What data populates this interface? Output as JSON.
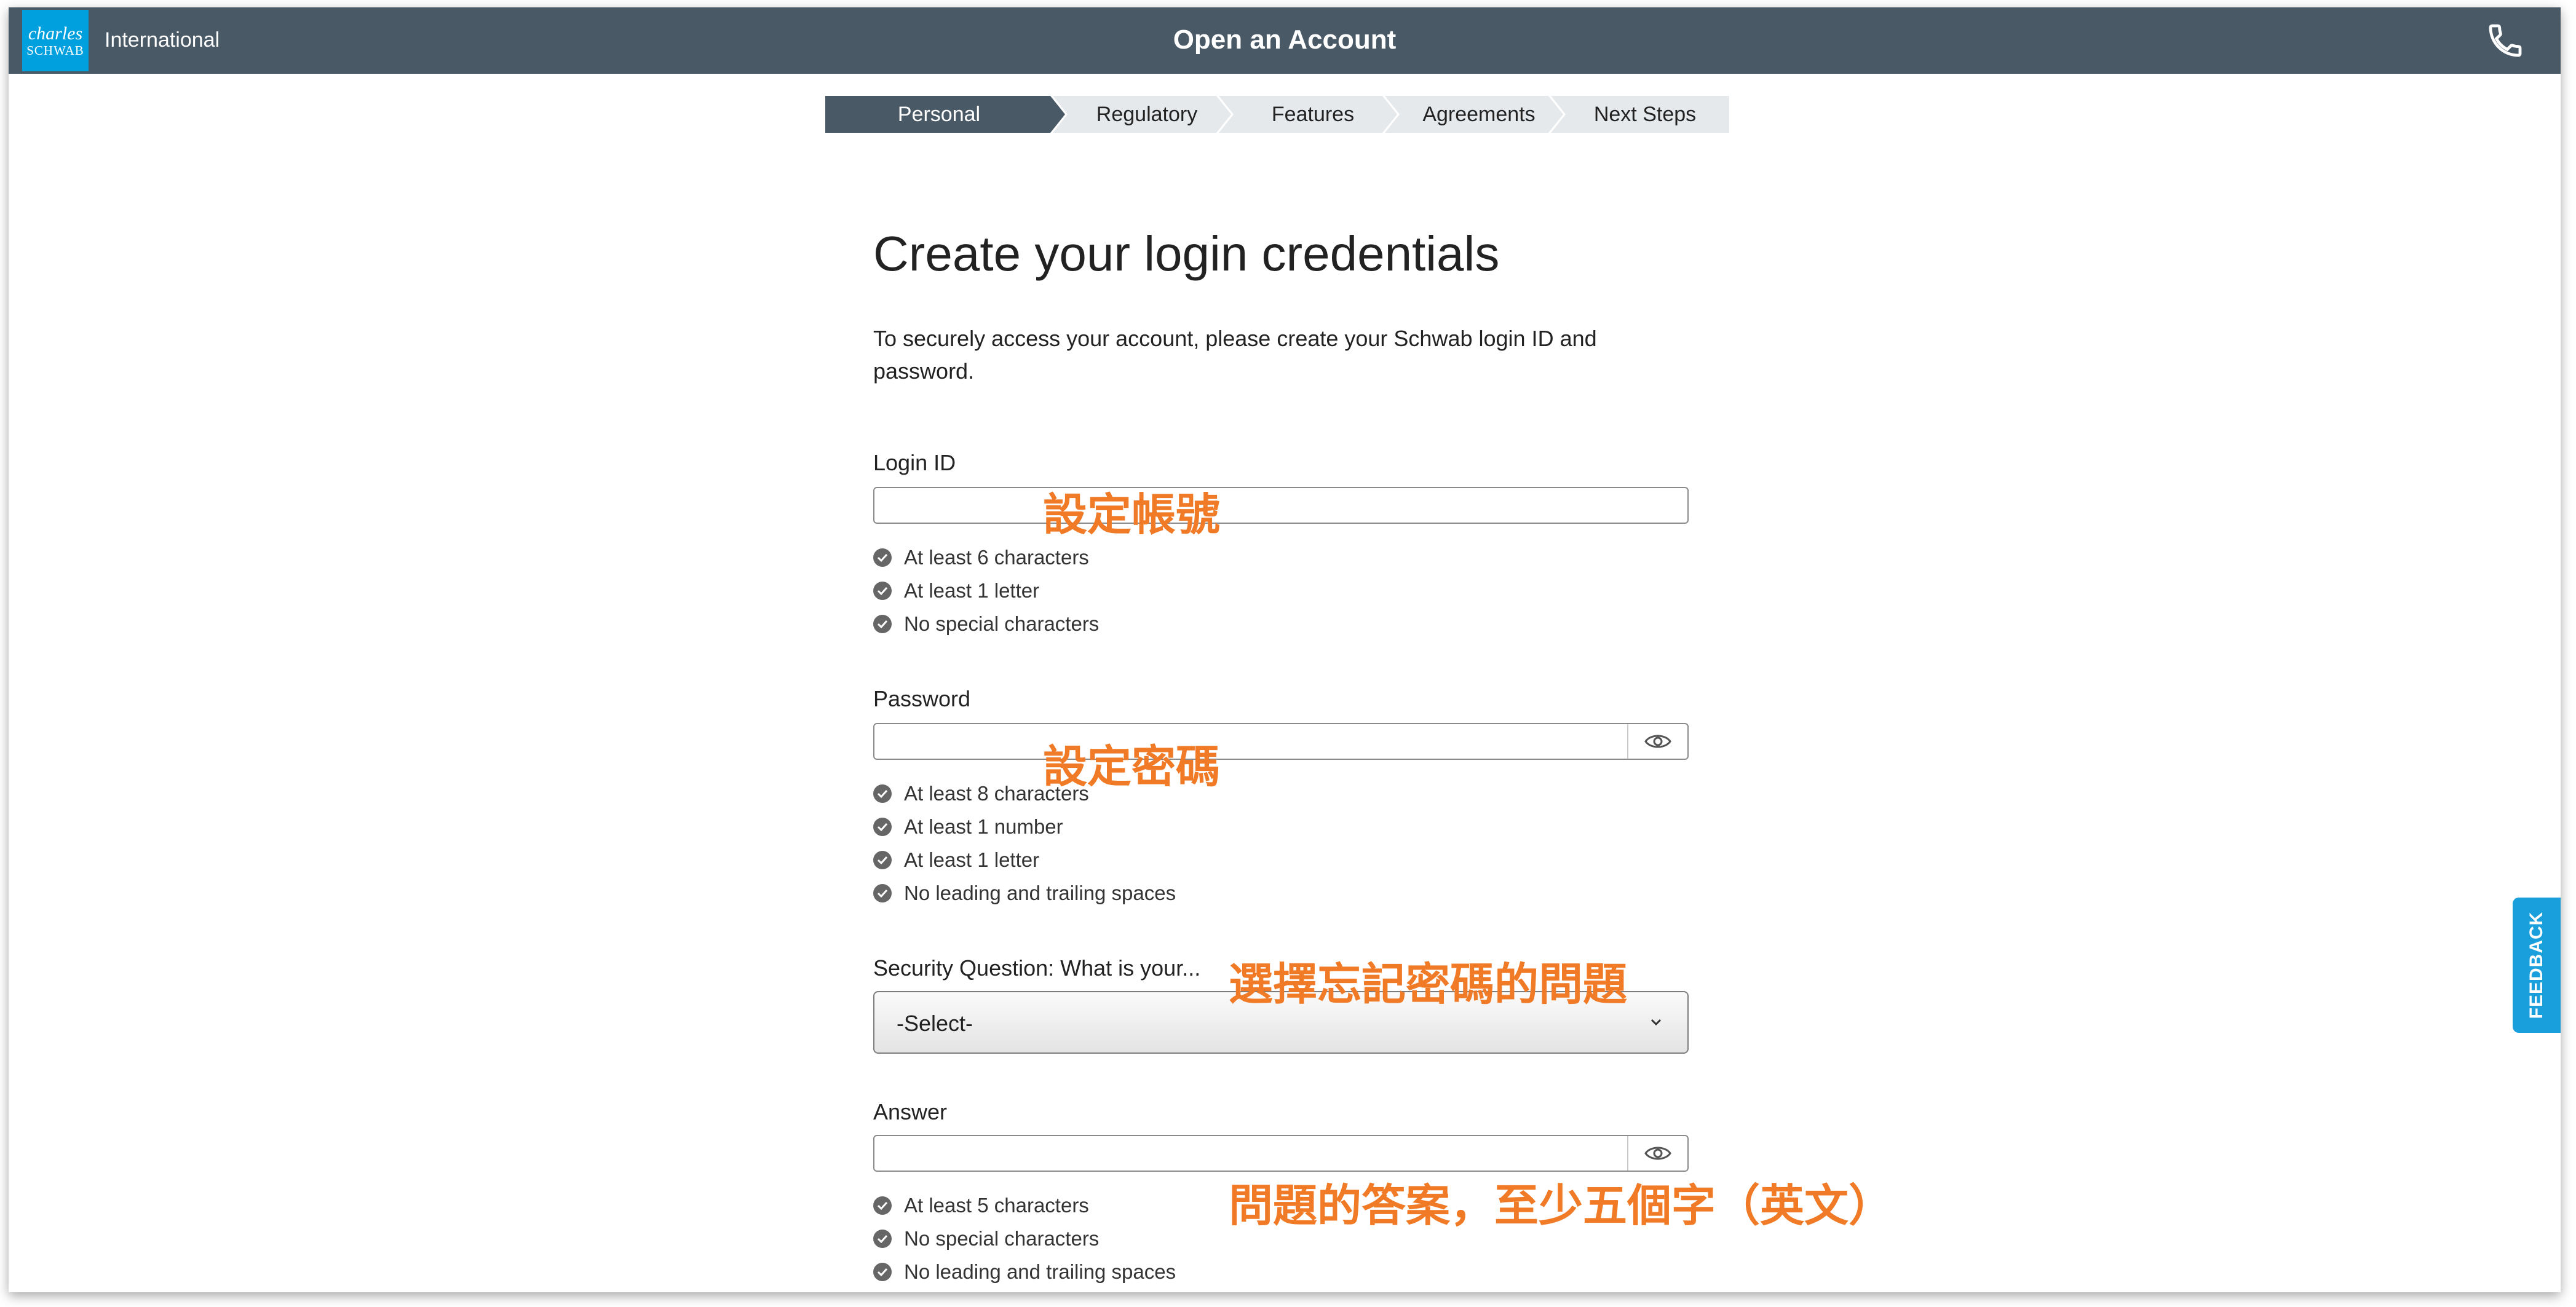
{
  "header": {
    "logo_line1": "charles",
    "logo_line2": "SCHWAB",
    "region": "International",
    "title": "Open an Account",
    "phone_icon": "phone-icon"
  },
  "steps": [
    {
      "label": "Personal",
      "active": true
    },
    {
      "label": "Regulatory",
      "active": false
    },
    {
      "label": "Features",
      "active": false
    },
    {
      "label": "Agreements",
      "active": false
    },
    {
      "label": "Next Steps",
      "active": false
    }
  ],
  "page": {
    "heading": "Create your login credentials",
    "intro": "To securely access your account, please create your Schwab login ID and password."
  },
  "login": {
    "label": "Login ID",
    "value": "",
    "rules": [
      "At least 6 characters",
      "At least 1 letter",
      "No special characters"
    ]
  },
  "password": {
    "label": "Password",
    "value": "",
    "rules": [
      "At least 8 characters",
      "At least 1 number",
      "At least 1 letter",
      "No leading and trailing spaces"
    ]
  },
  "security": {
    "label": "Security Question: What is your...",
    "selected": "-Select-"
  },
  "answer": {
    "label": "Answer",
    "value": "",
    "rules": [
      "At least 5 characters",
      "No special characters",
      "No leading and trailing spaces"
    ]
  },
  "annotations": {
    "login": "設定帳號",
    "password": "設定密碼",
    "security": "選擇忘記密碼的問題",
    "answer": "問題的答案，至少五個字（英文）"
  },
  "feedback": "FEEDBACK",
  "colors": {
    "header_bg": "#4a5966",
    "brand_blue": "#00a0df",
    "annotation": "#f07a26",
    "feedback_bg": "#1a9fdd"
  }
}
